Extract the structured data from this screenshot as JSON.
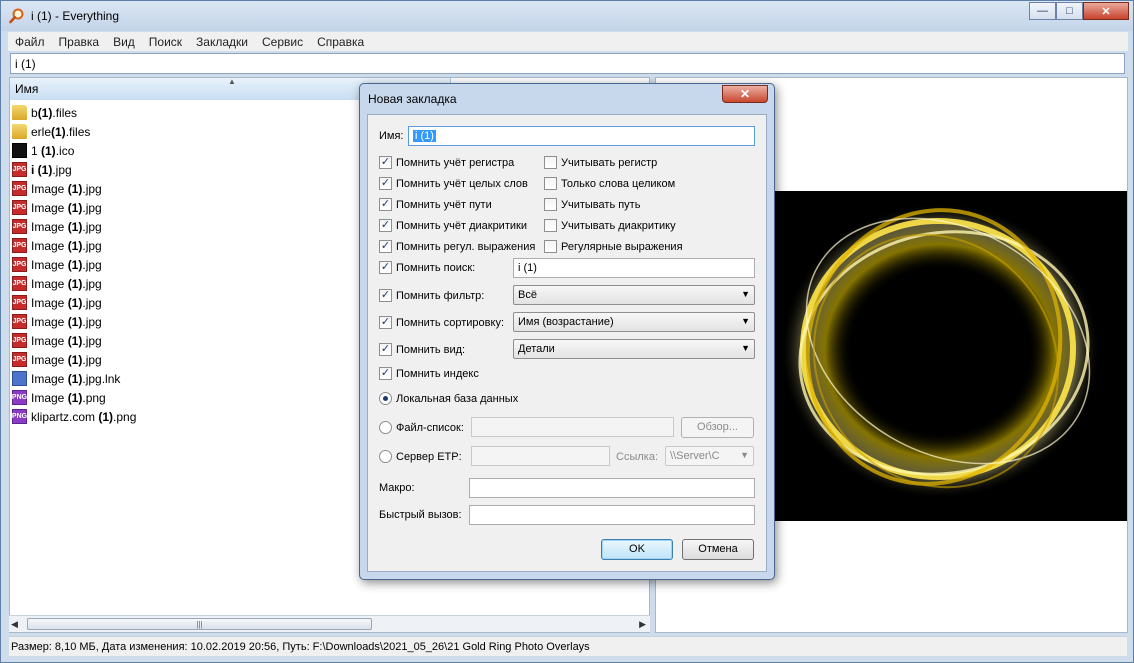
{
  "window": {
    "title": "i (1) - Everything",
    "controls": {
      "minimize": "—",
      "maximize": "□",
      "close": "✕"
    }
  },
  "menu": [
    "Файл",
    "Правка",
    "Вид",
    "Поиск",
    "Закладки",
    "Сервис",
    "Справка"
  ],
  "search": {
    "value": "i (1)"
  },
  "columns": {
    "name": "Имя"
  },
  "files": [
    {
      "prefix": "b",
      "match": "(1)",
      "suffix": ".files",
      "icon": "folder-icon",
      "tag": ""
    },
    {
      "prefix": "erle",
      "match": "(1)",
      "suffix": ".files",
      "icon": "folder-icon",
      "tag": ""
    },
    {
      "prefix": "1 ",
      "match": "(1)",
      "suffix": ".ico",
      "icon": "ico-file-icon",
      "tag": ""
    },
    {
      "prefix": "",
      "match": "i (1)",
      "suffix": ".jpg",
      "icon": "jpg-file-icon",
      "tag": "JPG"
    },
    {
      "prefix": "Image ",
      "match": "(1)",
      "suffix": ".jpg",
      "icon": "jpg-file-icon",
      "tag": "JPG"
    },
    {
      "prefix": "Image ",
      "match": "(1)",
      "suffix": ".jpg",
      "icon": "jpg-file-icon",
      "tag": "JPG"
    },
    {
      "prefix": "Image ",
      "match": "(1)",
      "suffix": ".jpg",
      "icon": "jpg-file-icon",
      "tag": "JPG"
    },
    {
      "prefix": "Image ",
      "match": "(1)",
      "suffix": ".jpg",
      "icon": "jpg-file-icon",
      "tag": "JPG"
    },
    {
      "prefix": "Image ",
      "match": "(1)",
      "suffix": ".jpg",
      "icon": "jpg-file-icon",
      "tag": "JPG"
    },
    {
      "prefix": "Image ",
      "match": "(1)",
      "suffix": ".jpg",
      "icon": "jpg-file-icon",
      "tag": "JPG"
    },
    {
      "prefix": "Image ",
      "match": "(1)",
      "suffix": ".jpg",
      "icon": "jpg-file-icon",
      "tag": "JPG"
    },
    {
      "prefix": "Image ",
      "match": "(1)",
      "suffix": ".jpg",
      "icon": "jpg-file-icon",
      "tag": "JPG"
    },
    {
      "prefix": "Image ",
      "match": "(1)",
      "suffix": ".jpg",
      "icon": "jpg-file-icon",
      "tag": "JPG"
    },
    {
      "prefix": "Image ",
      "match": "(1)",
      "suffix": ".jpg",
      "icon": "jpg-file-icon",
      "tag": "JPG"
    },
    {
      "prefix": "Image ",
      "match": "(1)",
      "suffix": ".jpg.lnk",
      "icon": "shortcut-file-icon",
      "tag": ""
    },
    {
      "prefix": "Image ",
      "match": "(1)",
      "suffix": ".png",
      "icon": "png-file-icon",
      "tag": "PNG"
    },
    {
      "prefix": "klipartz.com ",
      "match": "(1)",
      "suffix": ".png",
      "icon": "png-file-icon",
      "tag": "PNG"
    }
  ],
  "statusbar": "Размер: 8,10 МБ, Дата изменения: 10.02.2019 20:56, Путь: F:\\Downloads\\2021_05_26\\21 Gold Ring Photo Overlays",
  "dialog": {
    "title": "Новая закладка",
    "close": "✕",
    "name_label": "Имя:",
    "name_value": "i (1)",
    "options_left": [
      {
        "label": "Помнить учёт регистра",
        "checked": true
      },
      {
        "label": "Помнить учёт целых слов",
        "checked": true
      },
      {
        "label": "Помнить учёт пути",
        "checked": true
      },
      {
        "label": "Помнить учёт диакритики",
        "checked": true
      },
      {
        "label": "Помнить регул. выражения",
        "checked": true
      }
    ],
    "options_right": [
      {
        "label": "Учитывать регистр",
        "checked": false
      },
      {
        "label": "Только слова целиком",
        "checked": false
      },
      {
        "label": "Учитывать путь",
        "checked": false
      },
      {
        "label": "Учитывать диакритику",
        "checked": false
      },
      {
        "label": "Регулярные выражения",
        "checked": false
      }
    ],
    "remember_search": {
      "label": "Помнить поиск:",
      "value": "i (1)"
    },
    "remember_filter": {
      "label": "Помнить фильтр:",
      "value": "Всё"
    },
    "remember_sort": {
      "label": "Помнить сортировку:",
      "value": "Имя (возрастание)"
    },
    "remember_view": {
      "label": "Помнить вид:",
      "value": "Детали"
    },
    "remember_index": {
      "label": "Помнить индекс"
    },
    "local_db": {
      "label": "Локальная база данных"
    },
    "file_list": {
      "label": "Файл-список:",
      "browse": "Обзор..."
    },
    "ftp_server": {
      "label": "Сервер ETP:",
      "link_label": "Ссылка:",
      "link_value": "\\\\Server\\C"
    },
    "macro": {
      "label": "Макро:"
    },
    "hotkey": {
      "label": "Быстрый вызов:"
    },
    "ok": "OK",
    "cancel": "Отмена"
  },
  "colors": {
    "accent": "#3399ff",
    "ring": "#f2d200"
  }
}
